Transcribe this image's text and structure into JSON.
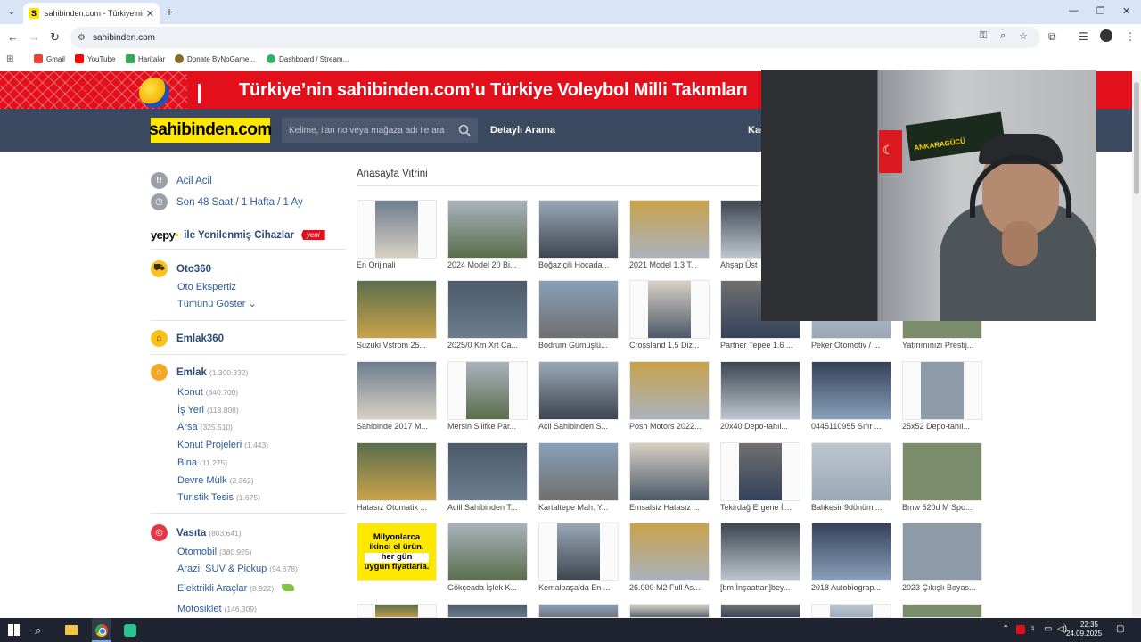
{
  "browser": {
    "tab_title": "sahibinden.com - Türkiye'nin Online",
    "tab_favicon": "S",
    "new_tab": "+",
    "url": "sahibinden.com",
    "bookmarks": [
      "Gmail",
      "YouTube",
      "Haritalar",
      "Donate ByNoGame...",
      "Dashboard / Stream..."
    ]
  },
  "banner": {
    "text": "Türkiye’nin sahibinden.com’u Türkiye Voleybol Milli Takımları"
  },
  "header": {
    "logo": "sahibinden.com",
    "search_placeholder": "Kelime, ilan no veya mağaza adı ile ara",
    "detailed_search": "Detaylı Arama",
    "cut_link": "Kad"
  },
  "sidebar": {
    "acil": "Acil Acil",
    "son48": "Son 48 Saat / 1 Hafta / 1 Ay",
    "yepy_logo": "yepy",
    "yepy_text": "ile Yenilenmiş Cihazlar",
    "yepy_badge": "yeni",
    "oto360": "Oto360",
    "oto_ekspertiz": "Oto Ekspertiz",
    "show_all": "Tümünü Göster",
    "emlak360": "Emlak360",
    "emlak": {
      "label": "Emlak",
      "count": "(1.300.332)"
    },
    "emlak_items": [
      {
        "label": "Konut",
        "count": "(840.700)"
      },
      {
        "label": "İş Yeri",
        "count": "(118.808)"
      },
      {
        "label": "Arsa",
        "count": "(325.510)"
      },
      {
        "label": "Konut Projeleri",
        "count": "(1.443)"
      },
      {
        "label": "Bina",
        "count": "(11.275)"
      },
      {
        "label": "Devre Mülk",
        "count": "(2.362)"
      },
      {
        "label": "Turistik Tesis",
        "count": "(1.675)"
      }
    ],
    "vasita": {
      "label": "Vasıta",
      "count": "(803.641)"
    },
    "vasita_items": [
      {
        "label": "Otomobil",
        "count": "(380.925)"
      },
      {
        "label": "Arazi, SUV & Pickup",
        "count": "(94.678)"
      },
      {
        "label": "Elektrikli Araçlar",
        "count": "(8.922)"
      },
      {
        "label": "Motosiklet",
        "count": "(146.309)"
      }
    ]
  },
  "showcase": {
    "title": "Anasayfa Vitrini",
    "promo": [
      "Milyonlarca",
      "ikinci el ürün,",
      "her gün",
      "uygun fiyatlarla."
    ],
    "items": [
      "En Orijinali",
      "2024 Model 20 Bi...",
      "Boğaziçili Hocada...",
      "2021 Model 1.3 T...",
      "Ahşap Üst",
      "",
      "",
      "Suzuki Vstrom 25...",
      "2025/0 Km Xrt Ca...",
      "Bodrum Gümüşlü...",
      "Crossland 1.5 Diz...",
      "Partner Tepee 1.6 ...",
      "Peker Otomotiv / ...",
      "Yatırımınızı Prestij...",
      "Sahibinde 2017 M...",
      "Mersin Silifke Par...",
      "Acil Sahibinden S...",
      "Posh Motors 2022...",
      "20x40 Depo-tahıl...",
      "0445110955 Sıfır ...",
      "25x52 Depo-tahıl...",
      "Hatasız Otomatik ...",
      "Acill Sahibinden T...",
      "Kartaltepe Mah. Y...",
      "Emsalsiz Hatasız ...",
      "Tekirdağ Ergene İl...",
      "Balıkesir 9dönüm ...",
      "Bmw 520d M Spo...",
      "",
      "Gökçeada İşlek K...",
      "Kemalpaşa'da En ...",
      "26.000 M2 Full As...",
      "[bm İnşaattan]bey...",
      "2018 Autobiograp...",
      "2023 Çıkışlı Boyas..."
    ]
  },
  "webcam": {
    "scarf_text": "ANKARAGÜCÜ"
  },
  "taskbar": {
    "time": "22:35",
    "date": "24.09.2025"
  }
}
